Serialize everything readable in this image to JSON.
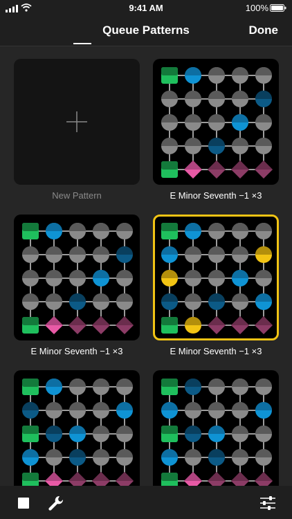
{
  "status": {
    "time": "9:41 AM",
    "battery": "100%"
  },
  "nav": {
    "title": "Queue Patterns",
    "done_label": "Done"
  },
  "new_pattern": {
    "label": "New Pattern"
  },
  "patterns": [
    {
      "name": "E Minor Seventh −1 ×3",
      "selected": false,
      "cells": [
        "G",
        "B",
        "M",
        "M",
        "M",
        "M",
        "M",
        "M",
        "M",
        "D",
        "M",
        "M",
        "M",
        "B",
        "M",
        "M",
        "M",
        "D",
        "M",
        "M",
        "G",
        "P",
        "R",
        "R",
        "R"
      ]
    },
    {
      "name": "E Minor Seventh −1 ×3",
      "selected": false,
      "cells": [
        "G",
        "B",
        "M",
        "M",
        "M",
        "M",
        "M",
        "M",
        "M",
        "D",
        "M",
        "M",
        "M",
        "B",
        "M",
        "M",
        "M",
        "D",
        "M",
        "M",
        "G",
        "P",
        "R",
        "R",
        "R"
      ]
    },
    {
      "name": "E Minor Seventh −1 ×3",
      "selected": true,
      "cells": [
        "G",
        "B",
        "M",
        "M",
        "M",
        "B",
        "M",
        "M",
        "M",
        "Y",
        "Y",
        "M",
        "M",
        "B",
        "M",
        "D",
        "M",
        "D",
        "M",
        "B",
        "G",
        "Y",
        "R",
        "R",
        "R"
      ]
    },
    {
      "name": "",
      "selected": false,
      "cells": [
        "G",
        "B",
        "M",
        "M",
        "M",
        "D",
        "M",
        "M",
        "M",
        "B",
        "G",
        "D",
        "B",
        "M",
        "M",
        "B",
        "M",
        "D",
        "M",
        "M",
        "G",
        "P",
        "R",
        "R",
        "R"
      ]
    },
    {
      "name": "",
      "selected": false,
      "cells": [
        "G",
        "D",
        "M",
        "M",
        "M",
        "B",
        "M",
        "M",
        "M",
        "B",
        "G",
        "D",
        "B",
        "M",
        "M",
        "B",
        "M",
        "D",
        "M",
        "M",
        "G",
        "P",
        "R",
        "R",
        "R"
      ]
    }
  ],
  "colors": {
    "green": "#1fbf5d",
    "blue": "#0f93d4",
    "dark_blue": "#0c5a86",
    "gray": "#8a8a8a",
    "pink": "#e85aa6",
    "plum": "#8c3c66",
    "yellow": "#f2c414",
    "selection": "#f2c414"
  },
  "toolbar": {
    "icons": [
      "stop-icon",
      "wrench-icon",
      "sliders-icon"
    ]
  }
}
